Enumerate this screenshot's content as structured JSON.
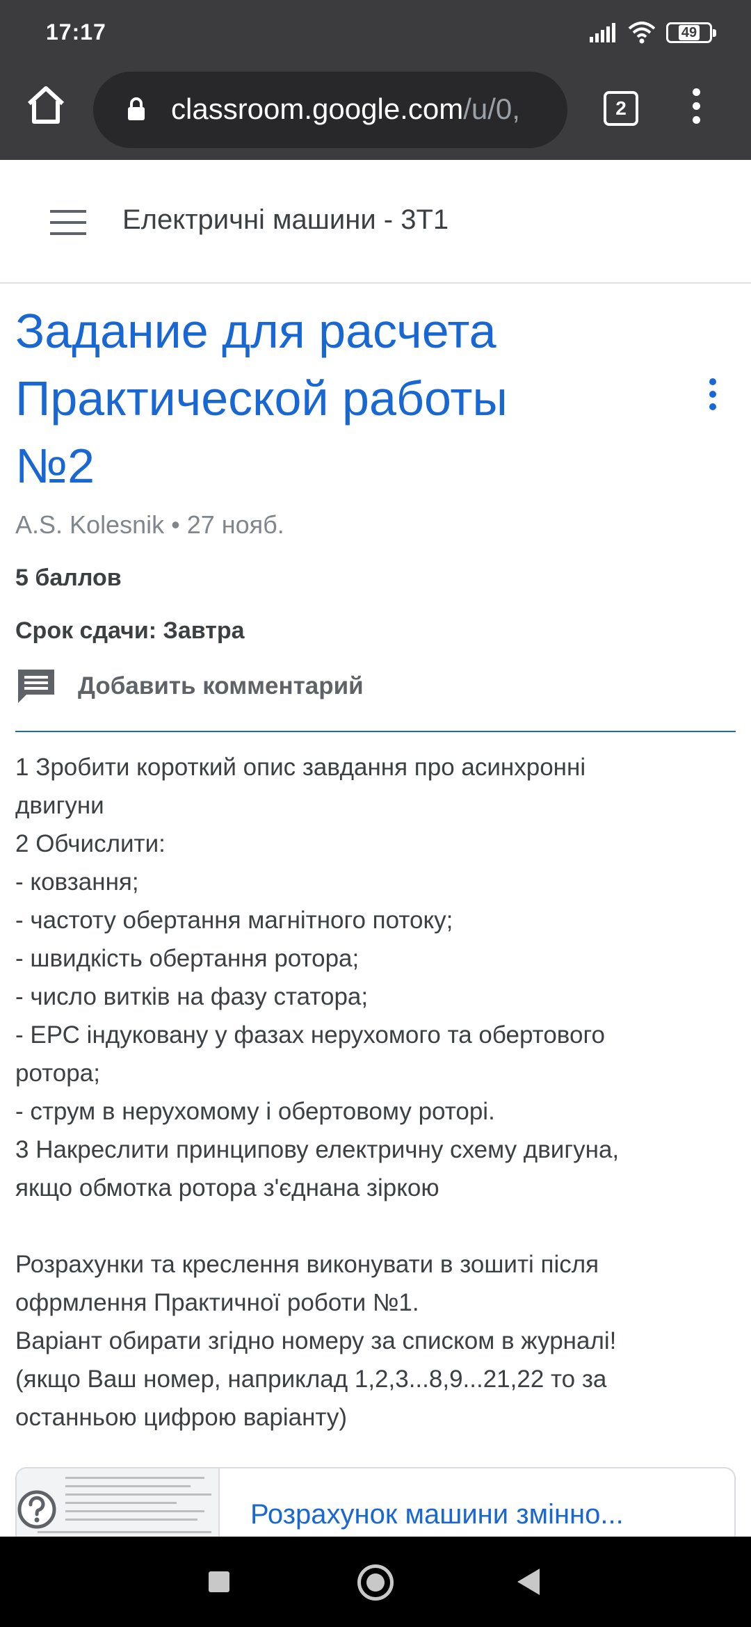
{
  "status_bar": {
    "time": "17:17",
    "battery": "49",
    "icons": [
      "signal-icon",
      "wifi-icon",
      "battery-icon"
    ]
  },
  "browser": {
    "url_host": "classroom.google.com",
    "url_path": "/u/0,",
    "tab_count": "2",
    "icons": [
      "home-icon",
      "lock-icon",
      "tabs-icon",
      "more-vert-icon"
    ]
  },
  "app_bar": {
    "class_name": "Електричні машини - 3Т1",
    "icons": [
      "hamburger-menu-icon"
    ]
  },
  "assignment": {
    "title_lines": [
      "Задание для расчета",
      "Практической работы",
      "№2"
    ],
    "meta": "A.S. Kolesnik • 27 нояб.",
    "points": "5 баллов",
    "due": "Срок сдачи: Завтра",
    "add_comment": "Добавить комментарий",
    "accent_color": "#1967d2"
  },
  "description": [
    "1 Зробити короткий опис завдання про асинхронні",
    "двигуни",
    "2 Обчислити:",
    "- ковзання;",
    "- частоту обертання магнітного потоку;",
    "- швидкість обертання ротора;",
    "- число витків на фазу статора;",
    "- ЕРС індуковану  у фазах нерухомого та обертового",
    "ротора;",
    "- струм в нерухомому і обертовому роторі.",
    "3 Накреслити принципову електричну схему двигуна,",
    "якщо обмотка ротора з'єднана зіркою",
    "",
    "Розрахунки та  креслення виконувати в зошиті після",
    "офрмлення Практичної роботи №1.",
    "Варіант обирати згідно номеру за списком в журналі!",
    "(якщо Ваш номер, наприклад 1,2,3...8,9...21,22 то за",
    "останньою цифрою варіанту)"
  ],
  "attachment": {
    "title": "Розрахунок машини змінно..."
  },
  "nav_bar": {
    "icons": [
      "recents-icon",
      "home-nav-icon",
      "back-icon"
    ]
  }
}
